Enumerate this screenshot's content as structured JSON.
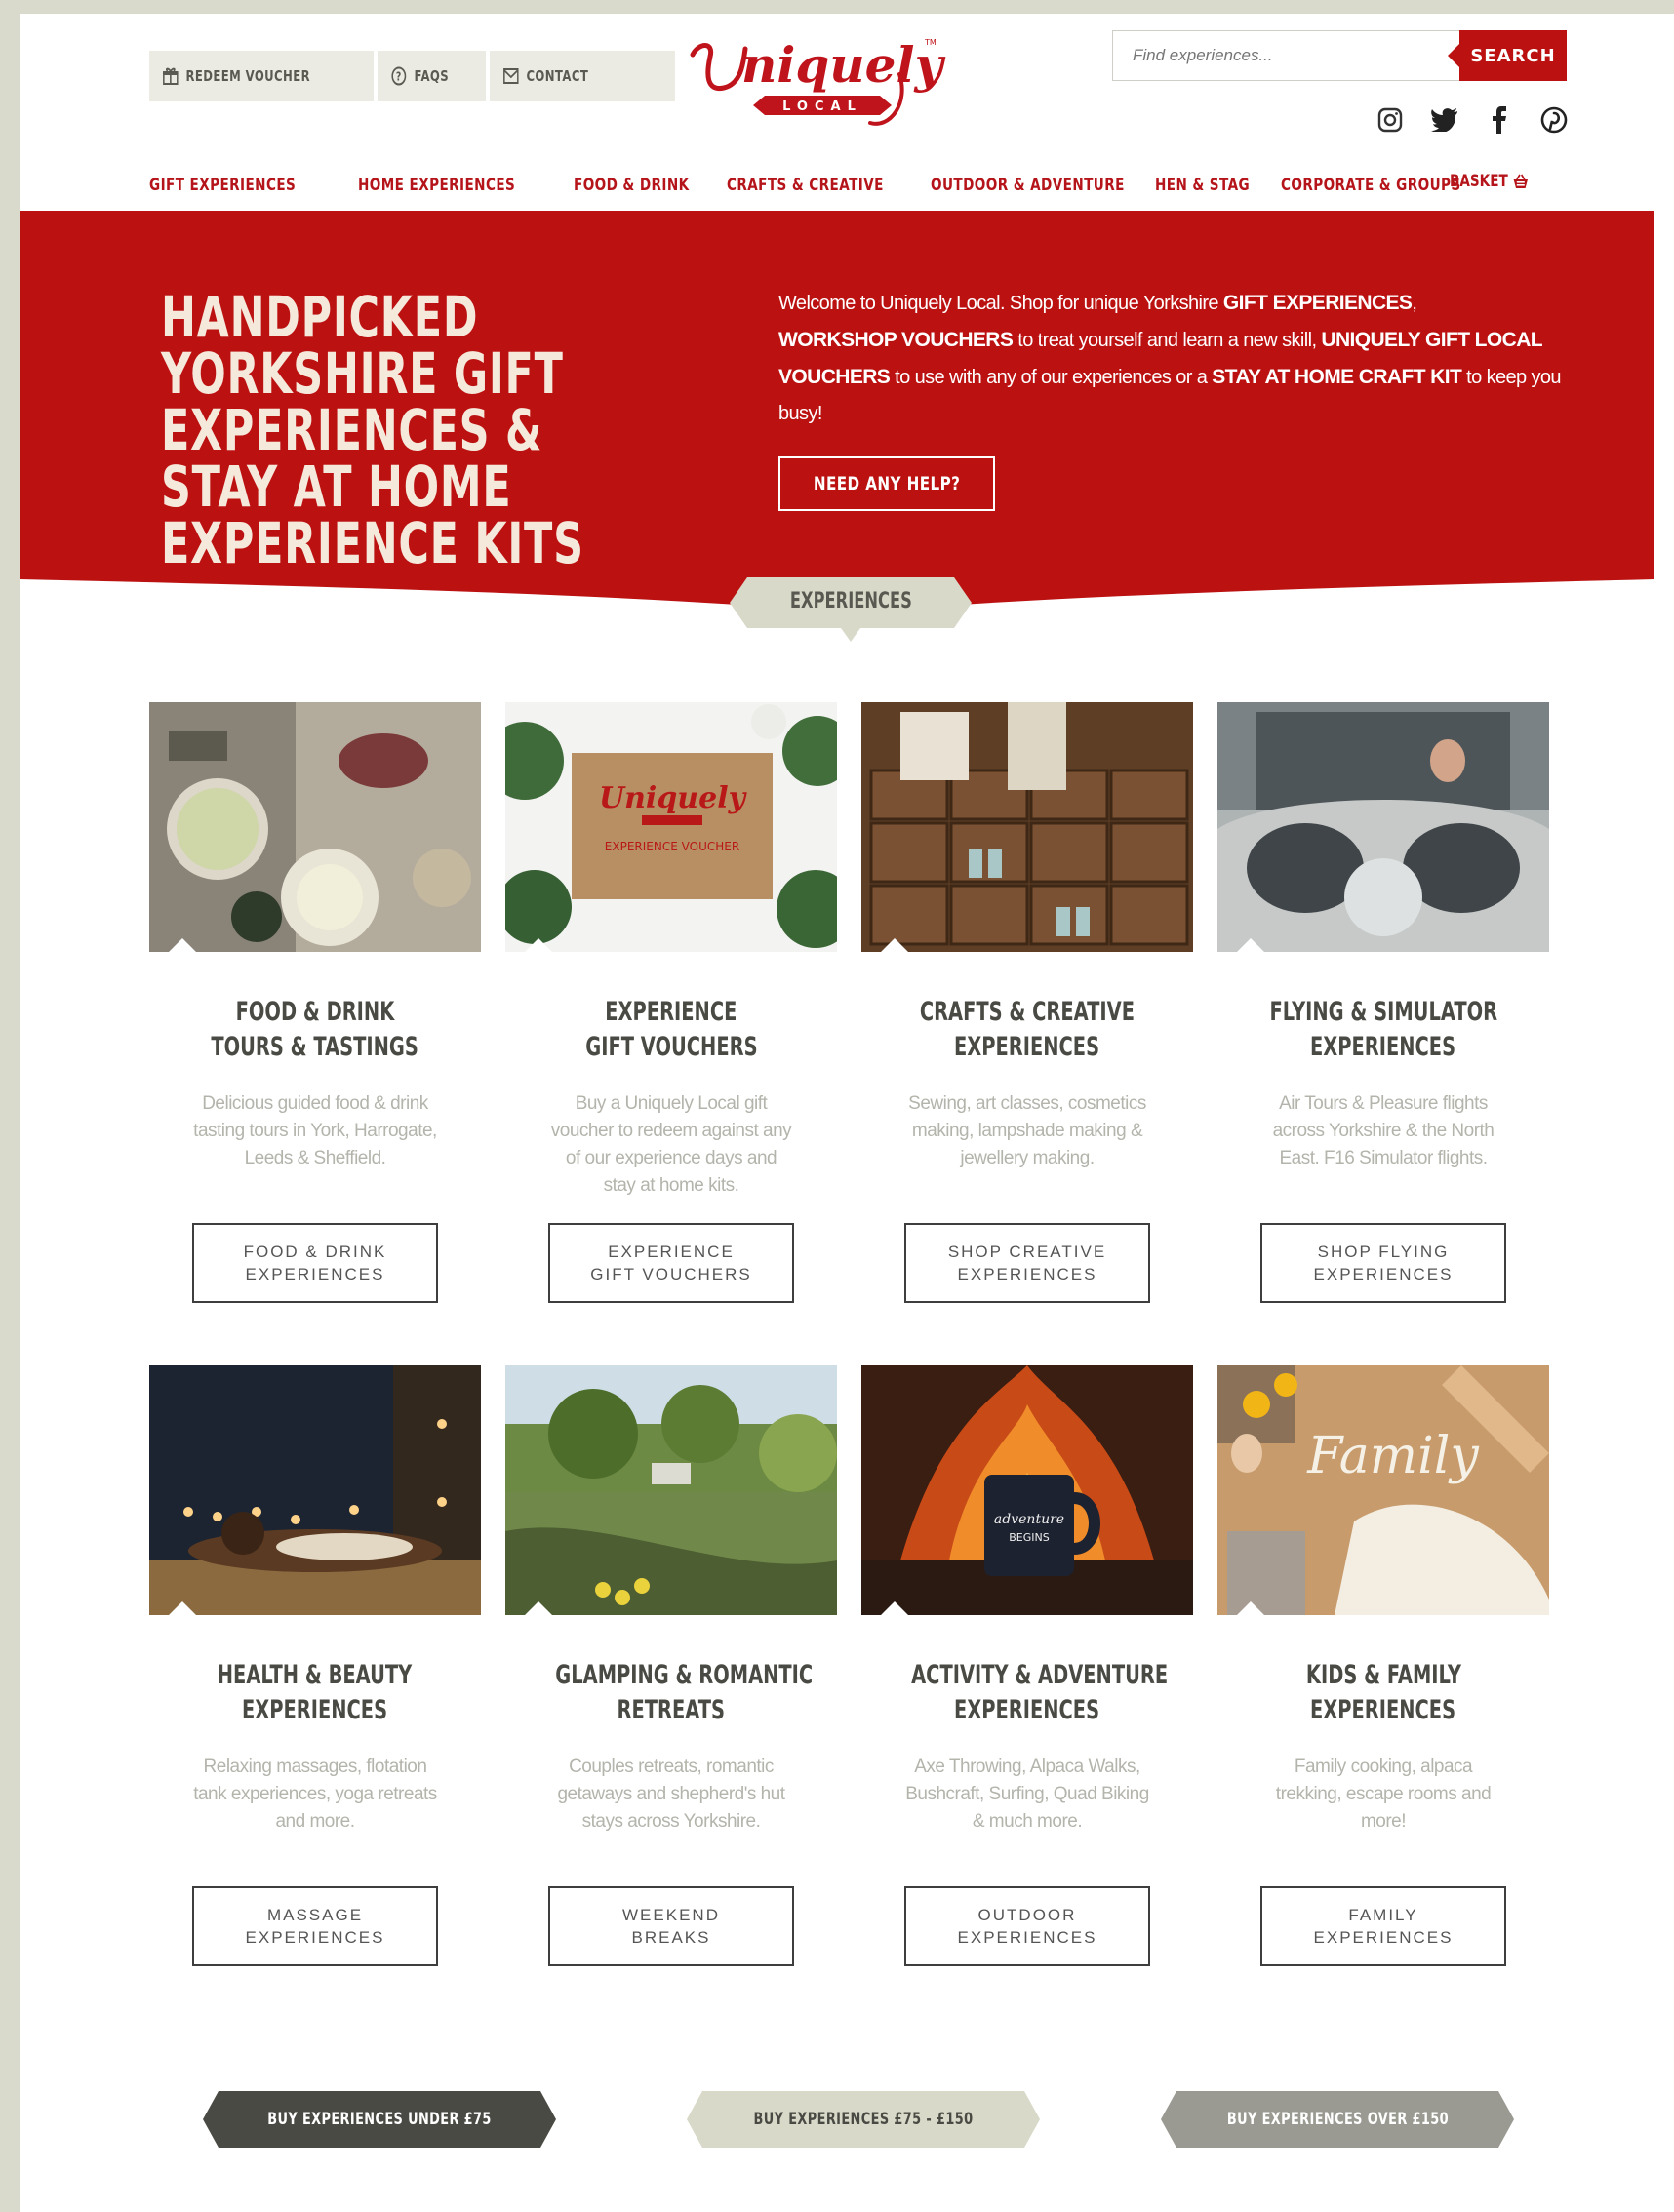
{
  "utility_nav": [
    {
      "label": "REDEEM VOUCHER",
      "icon": "gift-icon"
    },
    {
      "label": "FAQS",
      "icon": "question-icon"
    },
    {
      "label": "CONTACT",
      "icon": "mail-icon"
    }
  ],
  "logo": {
    "text": "Uniquely",
    "sub": "LOCAL"
  },
  "search": {
    "placeholder": "Find experiences...",
    "button": "SEARCH"
  },
  "social": [
    "instagram-icon",
    "twitter-icon",
    "facebook-icon",
    "pinterest-icon"
  ],
  "main_nav": [
    "GIFT EXPERIENCES",
    "HOME EXPERIENCES",
    "FOOD & DRINK",
    "CRAFTS & CREATIVE",
    "OUTDOOR & ADVENTURE",
    "HEN & STAG",
    "CORPORATE & GROUPS"
  ],
  "basket": {
    "label": "BASKET"
  },
  "hero": {
    "title": "HANDPICKED YORKSHIRE GIFT EXPERIENCES & STAY AT HOME EXPERIENCE KITS",
    "intro_1": "Welcome to Uniquely Local. Shop for unique Yorkshire ",
    "bold_1": "GIFT EXPERIENCES",
    "sep_1": ", ",
    "bold_2": "WORKSHOP VOUCHERS",
    "intro_2": " to treat yourself and learn a new skill, ",
    "bold_3": "UNIQUELY GIFT LOCAL VOUCHERS",
    "intro_3": " to use with any of our experiences  or a ",
    "bold_4": "STAY AT HOME CRAFT KIT",
    "intro_4": " to keep you busy!",
    "help_button": "NEED ANY HELP?",
    "color": "#bb1111"
  },
  "experiences_tab": "EXPERIENCES",
  "cards": [
    {
      "title_1": "FOOD & DRINK",
      "title_2": "TOURS & TASTINGS",
      "desc": "Delicious guided food & drink tasting tours in York, Harrogate, Leeds & Sheffield.",
      "btn_1": "FOOD & DRINK",
      "btn_2": "EXPERIENCES",
      "image": "food-table"
    },
    {
      "title_1": "EXPERIENCE",
      "title_2": "GIFT VOUCHERS",
      "desc": "Buy a Uniquely Local gift voucher to redeem against any of our experience days and stay at home kits.",
      "btn_1": "EXPERIENCE",
      "btn_2": "GIFT VOUCHERS",
      "image": "voucher-card"
    },
    {
      "title_1": "CRAFTS & CREATIVE",
      "title_2": "EXPERIENCES",
      "desc": "Sewing, art classes, cosmetics making, lampshade making & jewellery making.",
      "btn_1": "SHOP CREATIVE",
      "btn_2": "EXPERIENCES",
      "image": "craft-drawers"
    },
    {
      "title_1": "FLYING & SIMULATOR",
      "title_2": "EXPERIENCES",
      "desc": "Air Tours & Pleasure flights across Yorkshire & the North East. F16 Simulator flights.",
      "btn_1": "SHOP FLYING",
      "btn_2": "EXPERIENCES",
      "image": "cockpit"
    },
    {
      "title_1": "HEALTH & BEAUTY",
      "title_2": "EXPERIENCES",
      "desc": "Relaxing massages, flotation tank experiences, yoga retreats and more.",
      "btn_1": "MASSAGE",
      "btn_2": "EXPERIENCES",
      "image": "spa"
    },
    {
      "title_1": "GLAMPING & ROMANTIC",
      "title_2": "RETREATS",
      "desc": "Couples retreats, romantic getaways and shepherd's hut stays across Yorkshire.",
      "btn_1": "WEEKEND",
      "btn_2": "BREAKS",
      "image": "countryside"
    },
    {
      "title_1": "ACTIVITY & ADVENTURE",
      "title_2": "EXPERIENCES",
      "desc": "Axe Throwing, Alpaca Walks, Bushcraft, Surfing, Quad Biking & much more.",
      "btn_1": "OUTDOOR",
      "btn_2": "EXPERIENCES",
      "image": "campfire-mug"
    },
    {
      "title_1": "KIDS & FAMILY",
      "title_2": "EXPERIENCES",
      "desc": "Family cooking, alpaca trekking, escape rooms and more!",
      "btn_1": "FAMILY",
      "btn_2": "EXPERIENCES",
      "image": "flour-family"
    }
  ],
  "price_buttons": [
    {
      "label": "BUY EXPERIENCES UNDER £75",
      "bg": "#4a4a44",
      "fg": "#ffffff"
    },
    {
      "label": "BUY EXPERIENCES £75 - £150",
      "bg": "#d8d9c8",
      "fg": "#4a4a44"
    },
    {
      "label": "BUY EXPERIENCES OVER £150",
      "bg": "#9a9a92",
      "fg": "#ffffff"
    }
  ],
  "colors": {
    "brand_red": "#bb1111",
    "nav_red": "#b5151a",
    "frame": "#d9dacb"
  }
}
